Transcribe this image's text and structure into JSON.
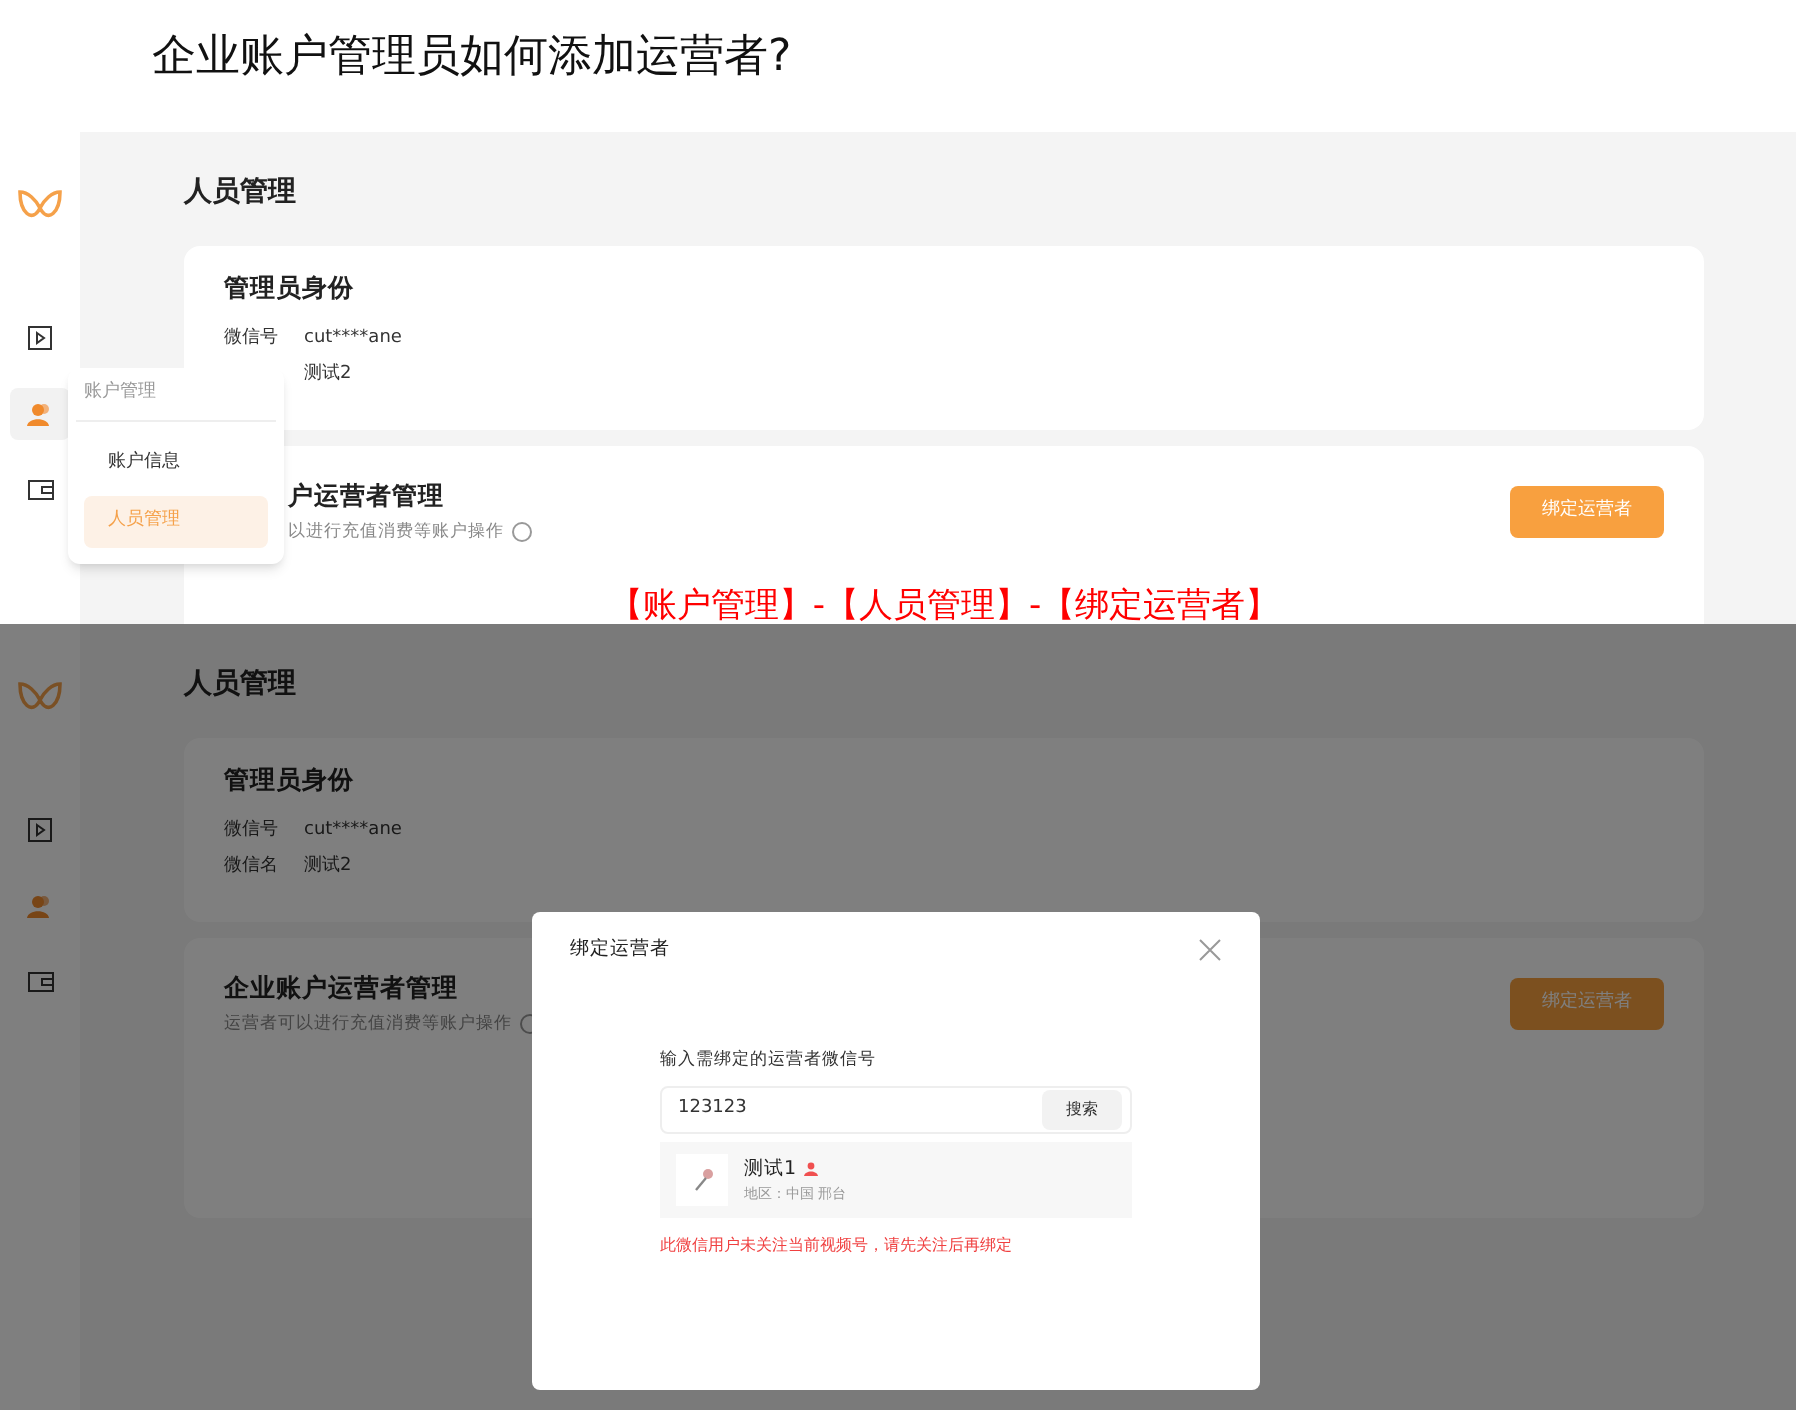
{
  "heading": "企业账户管理员如何添加运营者?",
  "screens": [
    {
      "page_title": "人员管理",
      "sidebar": [
        {
          "kind": "video",
          "selected": false
        },
        {
          "kind": "people",
          "selected": true
        },
        {
          "kind": "wallet",
          "selected": false
        }
      ],
      "admin_card": {
        "title": "管理员身份",
        "rows": [
          {
            "label": "微信号",
            "value": "cut****ane"
          },
          {
            "value": "测试2"
          }
        ]
      },
      "operator_card": {
        "title": "户运营者管理",
        "subtitle": "以进行充值消费等账户操作",
        "button": "绑定运营者"
      },
      "popup_menu": {
        "header": "账户管理",
        "items": [
          {
            "label": "账户信息",
            "selected": false
          },
          {
            "label": "人员管理",
            "selected": true
          }
        ]
      },
      "annotation": "【账户管理】-【人员管理】-【绑定运营者】"
    },
    {
      "page_title": "人员管理",
      "sidebar": [
        {
          "kind": "video"
        },
        {
          "kind": "people"
        },
        {
          "kind": "wallet"
        }
      ],
      "admin_card": {
        "title": "管理员身份",
        "rows": [
          {
            "label": "微信号",
            "value": "cut****ane"
          },
          {
            "label": "微信名",
            "value": "测试2"
          }
        ]
      },
      "operator_card": {
        "title": "企业账户运营者管理",
        "subtitle": "运营者可以进行充值消费等账户操作",
        "button": "绑定运营者"
      },
      "modal": {
        "title": "绑定运营者",
        "field_label": "输入需绑定的运营者微信号",
        "search_value": "123123",
        "search_button": "搜索",
        "result": {
          "name": "测试1",
          "region": "地区：中国 邢台"
        },
        "error": "此微信用户未关注当前视频号，请先关注后再绑定"
      }
    }
  ]
}
